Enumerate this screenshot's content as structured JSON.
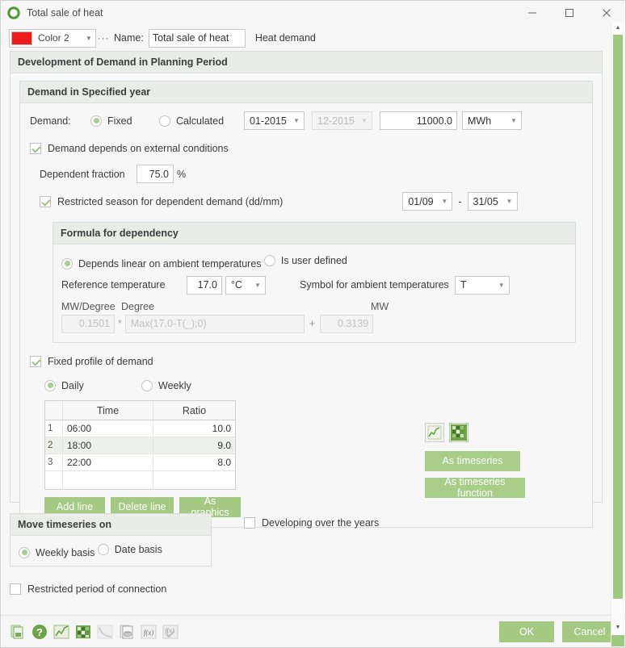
{
  "window": {
    "title": "Total sale of heat",
    "icon": "ring-icon",
    "minimize": "minimize-icon",
    "maximize": "maximize-icon",
    "close": "close-icon"
  },
  "header": {
    "color_label": "Color 2",
    "color_hex": "#ee1b1b",
    "ellipsis": "···",
    "name_label": "Name:",
    "name_value": "Total sale of heat",
    "category": "Heat demand"
  },
  "development_group": {
    "title": "Development of Demand in Planning Period"
  },
  "demand_group": {
    "title": "Demand in Specified year",
    "demand_label": "Demand:",
    "fixed_label": "Fixed",
    "fixed_selected": true,
    "calculated_label": "Calculated",
    "calculated_selected": false,
    "date_from": "01-2015",
    "date_to": "12-2015",
    "date_to_disabled": true,
    "amount": "11000.0",
    "unit": "MWh"
  },
  "external": {
    "depends_label": "Demand depends on external conditions",
    "depends_checked": true,
    "fraction_label": "Dependent fraction",
    "fraction_value": "75.0",
    "fraction_unit": "%",
    "restricted_label": "Restricted season for dependent demand (dd/mm)",
    "restricted_checked": true,
    "season_from": "01/09",
    "season_sep": "-",
    "season_to": "31/05"
  },
  "formula": {
    "title": "Formula for dependency",
    "linear_label": "Depends linear on ambient temperatures",
    "linear_selected": true,
    "userdefined_label": "Is user defined",
    "userdefined_selected": false,
    "ref_temp_label": "Reference temperature",
    "ref_temp_value": "17.0",
    "ref_temp_unit": "°C",
    "symbol_label": "Symbol for ambient temperatures",
    "symbol_value": "T",
    "col_slope": "MW/Degree",
    "col_degree": "Degree",
    "col_mw": "MW",
    "slope_value": "0.1501",
    "multiply_sign": "*",
    "degree_expression": "Max(17.0-T(_);0)",
    "plus_sign": "+",
    "offset_value": "0.3139"
  },
  "profile": {
    "fixed_profile_label": "Fixed profile of demand",
    "fixed_profile_checked": true,
    "daily_label": "Daily",
    "daily_selected": true,
    "weekly_label": "Weekly",
    "weekly_selected": false,
    "columns": [
      "",
      "Time",
      "Ratio"
    ],
    "rows": [
      {
        "index": "1",
        "time": "06:00",
        "ratio": "10.0"
      },
      {
        "index": "2",
        "time": "18:00",
        "ratio": "9.0"
      },
      {
        "index": "3",
        "time": "22:00",
        "ratio": "8.0"
      }
    ],
    "add_line": "Add line",
    "delete_line": "Delete line",
    "as_graphics": "As graphics"
  },
  "side_actions": {
    "chart_icon": "line-chart-icon",
    "grid_icon": "grid-matrix-icon",
    "as_timeseries": "As timeseries",
    "as_timeseries_function": "As timeseries function"
  },
  "move_group": {
    "title": "Move timeseries on",
    "weekly_basis_label": "Weekly basis",
    "weekly_basis_selected": true,
    "date_basis_label": "Date basis",
    "date_basis_selected": false
  },
  "developing": {
    "label": "Developing over the years",
    "checked": false
  },
  "restricted_period": {
    "label": "Restricted period of connection",
    "checked": false
  },
  "footer": {
    "icons": [
      "copy-document-icon",
      "help-icon",
      "line-chart-icon",
      "grid-matrix-icon",
      "curve-icon",
      "database-document-icon",
      "function-icon",
      "function-check-icon"
    ],
    "ok": "OK",
    "cancel": "Cancel"
  },
  "colors": {
    "accent_green": "#a3c982",
    "header_band": "#e9ece7",
    "scrollbar": "#9ccb7e"
  }
}
